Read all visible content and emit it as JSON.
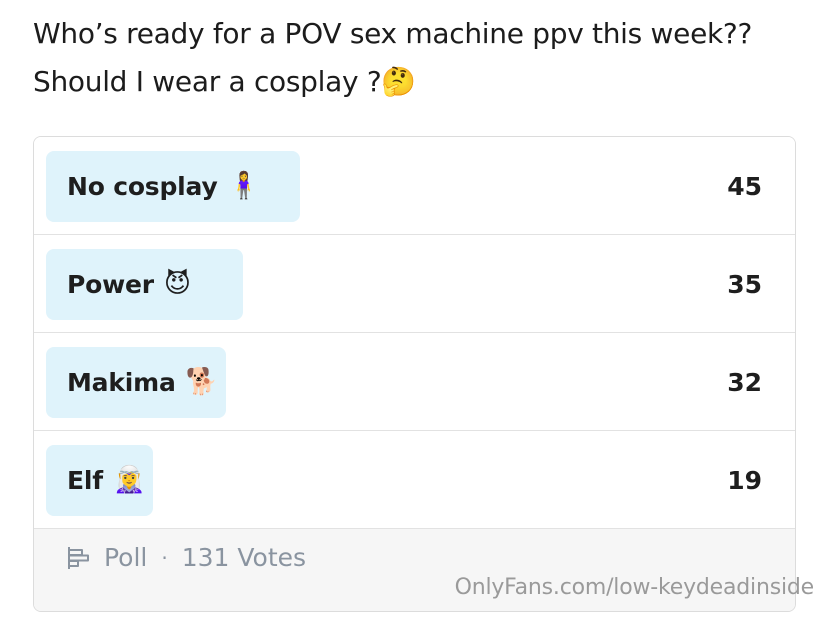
{
  "post": {
    "line1": "Who’s ready for a POV sex machine ppv this week??",
    "line2": "Should I wear a cosplay ?",
    "line2_emoji": "🤔"
  },
  "poll": {
    "options": [
      {
        "label": "No cosplay",
        "emoji": "🧍‍♀️",
        "votes": "45",
        "share": 0.344
      },
      {
        "label": "Power",
        "emoji": "😈",
        "votes": "35",
        "share": 0.267
      },
      {
        "label": "Makima",
        "emoji": "🐕",
        "votes": "32",
        "share": 0.244
      },
      {
        "label": "Elf",
        "emoji": "🧝‍♀️",
        "votes": "19",
        "share": 0.145
      }
    ],
    "footer": {
      "type_label": "Poll",
      "separator": "·",
      "votes_label": "131 Votes"
    },
    "fill_color": "#dff3fb"
  },
  "watermark": "OnlyFans.com/low-keydeadinside"
}
